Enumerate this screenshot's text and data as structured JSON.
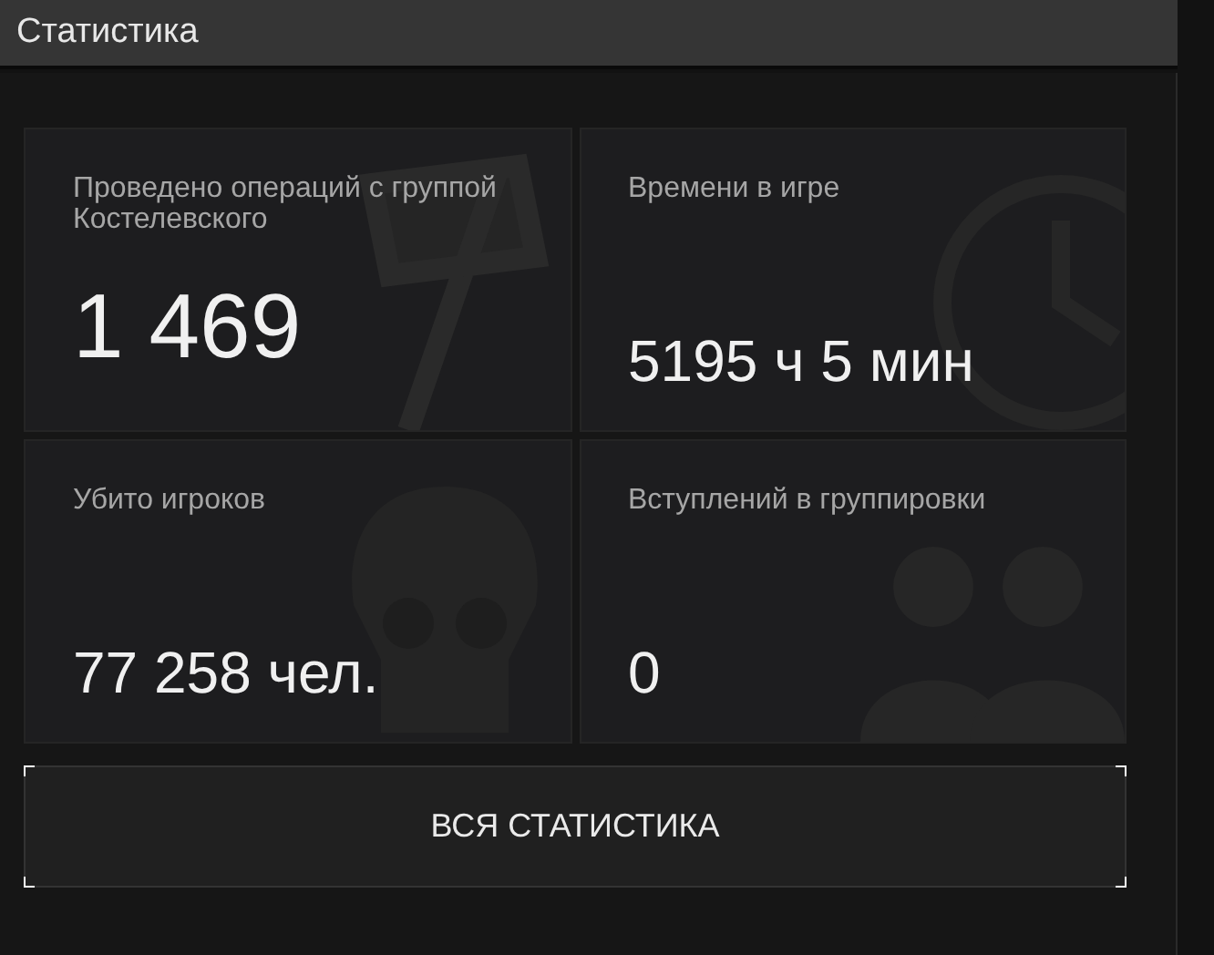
{
  "header": {
    "title": "Статистика"
  },
  "stats": [
    {
      "kind": "operations",
      "label": "Проведено операций с группой Костелевского",
      "value": "1 469"
    },
    {
      "kind": "time",
      "label": "Времени в игре",
      "value": "5195 ч 5 мин"
    },
    {
      "kind": "kills",
      "label": "Убито игроков",
      "value": "77 258 чел."
    },
    {
      "kind": "factions",
      "label": "Вступлений в группировки",
      "value": "0"
    }
  ],
  "button": {
    "label": "ВСЯ СТАТИСТИКА"
  }
}
